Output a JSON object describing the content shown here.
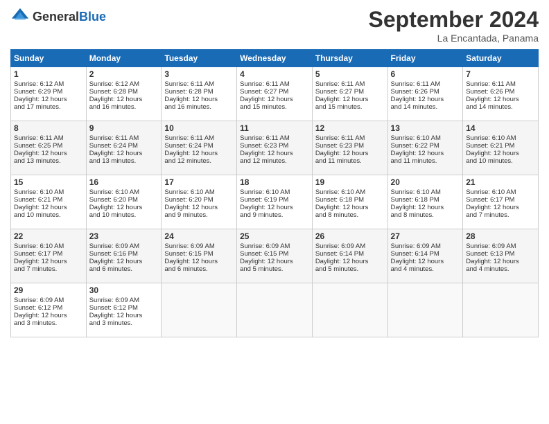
{
  "logo": {
    "general": "General",
    "blue": "Blue"
  },
  "header": {
    "month": "September 2024",
    "location": "La Encantada, Panama"
  },
  "days_of_week": [
    "Sunday",
    "Monday",
    "Tuesday",
    "Wednesday",
    "Thursday",
    "Friday",
    "Saturday"
  ],
  "weeks": [
    [
      {
        "day": "1",
        "lines": [
          "Sunrise: 6:12 AM",
          "Sunset: 6:29 PM",
          "Daylight: 12 hours",
          "and 17 minutes."
        ]
      },
      {
        "day": "2",
        "lines": [
          "Sunrise: 6:12 AM",
          "Sunset: 6:28 PM",
          "Daylight: 12 hours",
          "and 16 minutes."
        ]
      },
      {
        "day": "3",
        "lines": [
          "Sunrise: 6:11 AM",
          "Sunset: 6:28 PM",
          "Daylight: 12 hours",
          "and 16 minutes."
        ]
      },
      {
        "day": "4",
        "lines": [
          "Sunrise: 6:11 AM",
          "Sunset: 6:27 PM",
          "Daylight: 12 hours",
          "and 15 minutes."
        ]
      },
      {
        "day": "5",
        "lines": [
          "Sunrise: 6:11 AM",
          "Sunset: 6:27 PM",
          "Daylight: 12 hours",
          "and 15 minutes."
        ]
      },
      {
        "day": "6",
        "lines": [
          "Sunrise: 6:11 AM",
          "Sunset: 6:26 PM",
          "Daylight: 12 hours",
          "and 14 minutes."
        ]
      },
      {
        "day": "7",
        "lines": [
          "Sunrise: 6:11 AM",
          "Sunset: 6:26 PM",
          "Daylight: 12 hours",
          "and 14 minutes."
        ]
      }
    ],
    [
      {
        "day": "8",
        "lines": [
          "Sunrise: 6:11 AM",
          "Sunset: 6:25 PM",
          "Daylight: 12 hours",
          "and 13 minutes."
        ]
      },
      {
        "day": "9",
        "lines": [
          "Sunrise: 6:11 AM",
          "Sunset: 6:24 PM",
          "Daylight: 12 hours",
          "and 13 minutes."
        ]
      },
      {
        "day": "10",
        "lines": [
          "Sunrise: 6:11 AM",
          "Sunset: 6:24 PM",
          "Daylight: 12 hours",
          "and 12 minutes."
        ]
      },
      {
        "day": "11",
        "lines": [
          "Sunrise: 6:11 AM",
          "Sunset: 6:23 PM",
          "Daylight: 12 hours",
          "and 12 minutes."
        ]
      },
      {
        "day": "12",
        "lines": [
          "Sunrise: 6:11 AM",
          "Sunset: 6:23 PM",
          "Daylight: 12 hours",
          "and 11 minutes."
        ]
      },
      {
        "day": "13",
        "lines": [
          "Sunrise: 6:10 AM",
          "Sunset: 6:22 PM",
          "Daylight: 12 hours",
          "and 11 minutes."
        ]
      },
      {
        "day": "14",
        "lines": [
          "Sunrise: 6:10 AM",
          "Sunset: 6:21 PM",
          "Daylight: 12 hours",
          "and 10 minutes."
        ]
      }
    ],
    [
      {
        "day": "15",
        "lines": [
          "Sunrise: 6:10 AM",
          "Sunset: 6:21 PM",
          "Daylight: 12 hours",
          "and 10 minutes."
        ]
      },
      {
        "day": "16",
        "lines": [
          "Sunrise: 6:10 AM",
          "Sunset: 6:20 PM",
          "Daylight: 12 hours",
          "and 10 minutes."
        ]
      },
      {
        "day": "17",
        "lines": [
          "Sunrise: 6:10 AM",
          "Sunset: 6:20 PM",
          "Daylight: 12 hours",
          "and 9 minutes."
        ]
      },
      {
        "day": "18",
        "lines": [
          "Sunrise: 6:10 AM",
          "Sunset: 6:19 PM",
          "Daylight: 12 hours",
          "and 9 minutes."
        ]
      },
      {
        "day": "19",
        "lines": [
          "Sunrise: 6:10 AM",
          "Sunset: 6:18 PM",
          "Daylight: 12 hours",
          "and 8 minutes."
        ]
      },
      {
        "day": "20",
        "lines": [
          "Sunrise: 6:10 AM",
          "Sunset: 6:18 PM",
          "Daylight: 12 hours",
          "and 8 minutes."
        ]
      },
      {
        "day": "21",
        "lines": [
          "Sunrise: 6:10 AM",
          "Sunset: 6:17 PM",
          "Daylight: 12 hours",
          "and 7 minutes."
        ]
      }
    ],
    [
      {
        "day": "22",
        "lines": [
          "Sunrise: 6:10 AM",
          "Sunset: 6:17 PM",
          "Daylight: 12 hours",
          "and 7 minutes."
        ]
      },
      {
        "day": "23",
        "lines": [
          "Sunrise: 6:09 AM",
          "Sunset: 6:16 PM",
          "Daylight: 12 hours",
          "and 6 minutes."
        ]
      },
      {
        "day": "24",
        "lines": [
          "Sunrise: 6:09 AM",
          "Sunset: 6:15 PM",
          "Daylight: 12 hours",
          "and 6 minutes."
        ]
      },
      {
        "day": "25",
        "lines": [
          "Sunrise: 6:09 AM",
          "Sunset: 6:15 PM",
          "Daylight: 12 hours",
          "and 5 minutes."
        ]
      },
      {
        "day": "26",
        "lines": [
          "Sunrise: 6:09 AM",
          "Sunset: 6:14 PM",
          "Daylight: 12 hours",
          "and 5 minutes."
        ]
      },
      {
        "day": "27",
        "lines": [
          "Sunrise: 6:09 AM",
          "Sunset: 6:14 PM",
          "Daylight: 12 hours",
          "and 4 minutes."
        ]
      },
      {
        "day": "28",
        "lines": [
          "Sunrise: 6:09 AM",
          "Sunset: 6:13 PM",
          "Daylight: 12 hours",
          "and 4 minutes."
        ]
      }
    ],
    [
      {
        "day": "29",
        "lines": [
          "Sunrise: 6:09 AM",
          "Sunset: 6:12 PM",
          "Daylight: 12 hours",
          "and 3 minutes."
        ]
      },
      {
        "day": "30",
        "lines": [
          "Sunrise: 6:09 AM",
          "Sunset: 6:12 PM",
          "Daylight: 12 hours",
          "and 3 minutes."
        ]
      },
      {
        "day": "",
        "lines": []
      },
      {
        "day": "",
        "lines": []
      },
      {
        "day": "",
        "lines": []
      },
      {
        "day": "",
        "lines": []
      },
      {
        "day": "",
        "lines": []
      }
    ]
  ]
}
